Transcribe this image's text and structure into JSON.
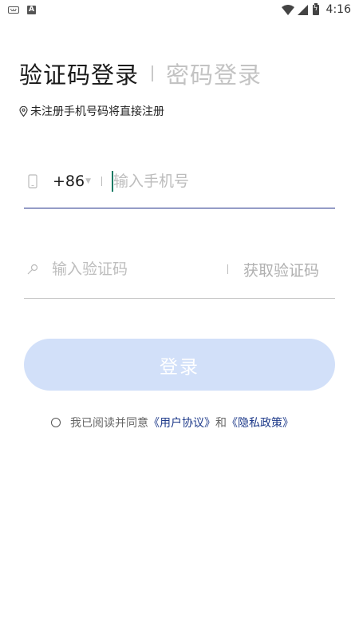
{
  "status_bar": {
    "keyboard_icon": "keyboard-icon",
    "a_icon_label": "A",
    "time": "4:16"
  },
  "tabs": {
    "active": "验证码登录",
    "inactive": "密码登录"
  },
  "hint": "未注册手机号码将直接注册",
  "phone": {
    "country_code": "+86",
    "placeholder": "输入手机号",
    "value": ""
  },
  "code": {
    "placeholder": "输入验证码",
    "value": "",
    "get_code_label": "获取验证码"
  },
  "login_button": "登录",
  "agreement": {
    "prefix": "我已阅读并同意",
    "user_agreement": "《用户协议》",
    "and": "和",
    "privacy_policy": "《隐私政策》"
  },
  "colors": {
    "accent": "#1e3a8a",
    "button_bg": "#d2e0f9",
    "cursor": "#137a63"
  }
}
